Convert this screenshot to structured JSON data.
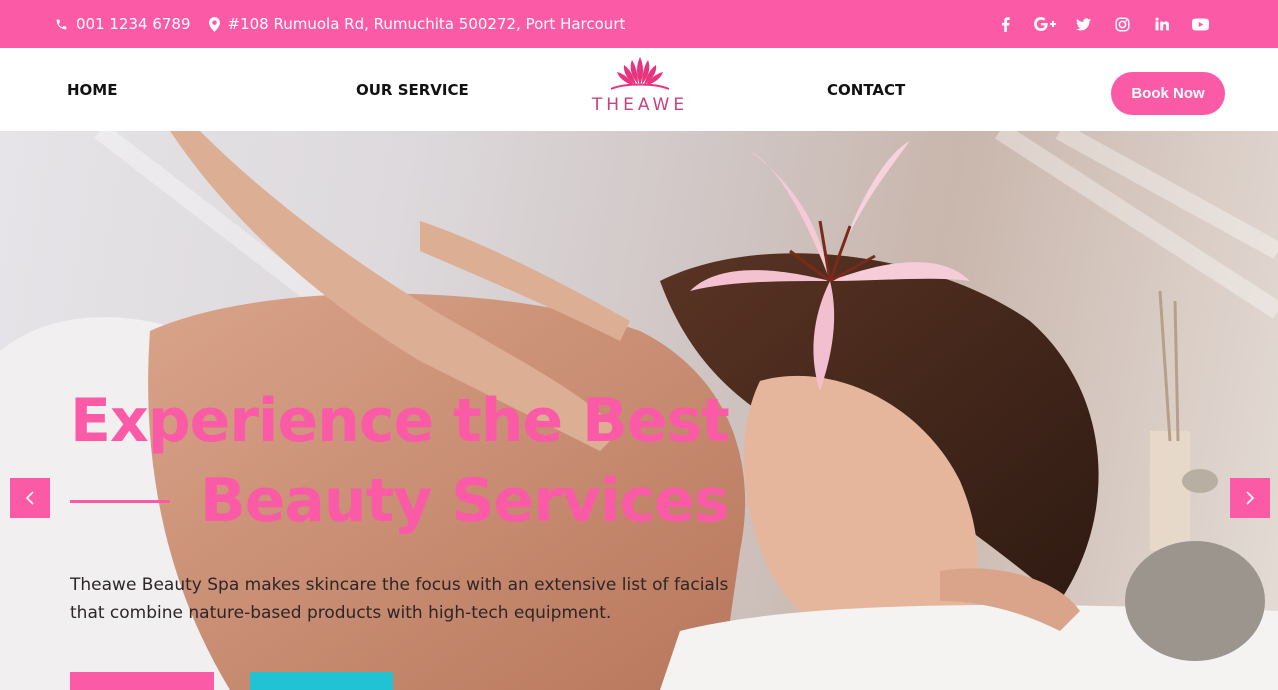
{
  "topbar": {
    "phone": "001 1234 6789",
    "address": "#108 Rumuola Rd, Rumuchita 500272, Port Harcourt",
    "socials": [
      "facebook-icon",
      "google-plus-icon",
      "twitter-icon",
      "instagram-icon",
      "linkedin-icon",
      "youtube-icon"
    ]
  },
  "nav": {
    "home": "HOME",
    "service": "OUR SERVICE",
    "contact": "CONTACT",
    "book_now": "Book Now"
  },
  "logo": {
    "text": "THEAWE"
  },
  "hero": {
    "title_line1": "Experience the Best",
    "title_line2": "Beauty Services",
    "description": "Theawe Beauty Spa makes skincare the focus with an extensive list of facials that combine nature-based products with high-tech equipment.",
    "prev_icon": "chevron-left-icon",
    "next_icon": "chevron-right-icon"
  },
  "colors": {
    "accent": "#fb5aa6",
    "teal": "#21c2d4",
    "text_dark": "#111111"
  }
}
